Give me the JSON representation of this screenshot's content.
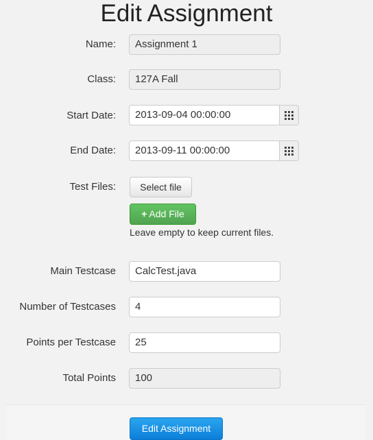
{
  "page": {
    "title": "Edit Assignment"
  },
  "form": {
    "name": {
      "label": "Name:",
      "value": "Assignment 1"
    },
    "class": {
      "label": "Class:",
      "value": "127A Fall"
    },
    "start_date": {
      "label": "Start Date:",
      "value": "2013-09-04 00:00:00",
      "icon": "calendar-icon"
    },
    "end_date": {
      "label": "End Date:",
      "value": "2013-09-11 00:00:00",
      "icon": "calendar-icon"
    },
    "test_files": {
      "label": "Test Files:",
      "select_button": "Select file",
      "add_button": "Add File",
      "add_icon": "plus-icon",
      "help": "Leave empty to keep current files."
    },
    "main_testcase": {
      "label": "Main Testcase",
      "value": "CalcTest.java"
    },
    "num_testcases": {
      "label": "Number of Testcases",
      "value": "4"
    },
    "points_per_testcase": {
      "label": "Points per Testcase",
      "value": "25"
    },
    "total_points": {
      "label": "Total Points",
      "value": "100"
    },
    "submit_button": "Edit Assignment"
  },
  "colors": {
    "success": "#5cb85c",
    "primary": "#1a8fe3",
    "background": "#f2f2f2"
  }
}
